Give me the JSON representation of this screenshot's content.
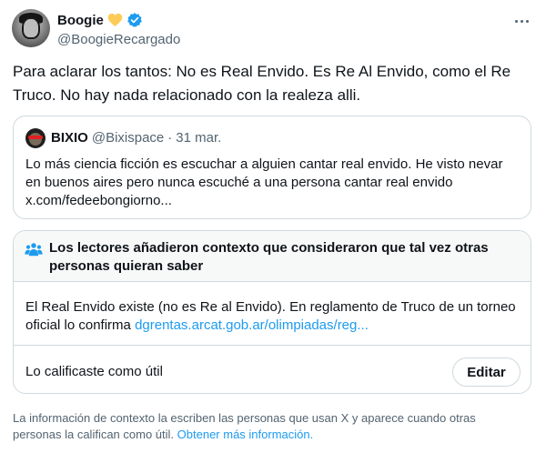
{
  "author": {
    "display_name": "Boogie",
    "handle": "@BoogieRecargado",
    "badge_emoji": "yellow-heart-icon",
    "verified_color": "#1d9bf0"
  },
  "tweet": {
    "text": "Para aclarar los tantos: No es Real Envido. Es Re Al Envido, como el Re Truco. No hay nada relacionado con la realeza alli."
  },
  "quote": {
    "name": "BIXIO",
    "handle": "@Bixispace",
    "separator": "·",
    "date": "31 mar.",
    "text": "Lo más ciencia ficción es escuchar a alguien cantar real envido. He visto nevar en buenos aires pero nunca escuché a una persona cantar real envido x.com/fedeebongiorno..."
  },
  "note": {
    "title": "Los lectores añadieron contexto que consideraron que tal vez otras personas quieran saber",
    "body": "El Real Envido existe (no es Re al Envido). En reglamento de Truco de un torneo oficial lo confirma",
    "link": "dgrentas.arcat.gob.ar/olimpiadas/reg...",
    "rated_label": "Lo calificaste como útil",
    "edit_label": "Editar"
  },
  "footer": {
    "text": "La información de contexto la escriben las personas que usan X y aparece cuando otras personas la califican como útil.",
    "link": "Obtener más información."
  },
  "colors": {
    "accent": "#1d9bf0",
    "secondary_text": "#536471",
    "border": "#cfd9de",
    "note_header_bg": "#f7f9f9"
  }
}
